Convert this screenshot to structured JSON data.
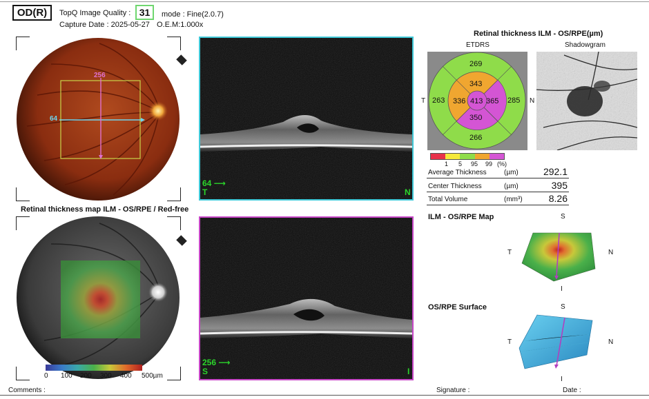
{
  "header": {
    "eye": "OD(R)",
    "quality_label": "TopQ Image Quality :",
    "quality_value": "31",
    "mode": "mode : Fine(2.0.7)",
    "capture_date": "Capture Date : 2025-05-27",
    "oem": "O.E.M:1.000x"
  },
  "fundus_top": {
    "scan_h_label": "64",
    "scan_v_label": "256"
  },
  "oct_top": {
    "scan_number": "64",
    "from_letter": "T",
    "to_letter": "N"
  },
  "oct_bottom": {
    "scan_number": "256",
    "from_letter": "S",
    "to_letter": "I"
  },
  "thickness_map": {
    "title": "Retinal thickness map ILM - OS/RPE / Red-free",
    "scale_ticks": [
      "0",
      "100",
      "200",
      "300",
      "400",
      "500µm"
    ]
  },
  "etdrs": {
    "section_title": "Retinal thickness ILM - OS/RPE(µm)",
    "etdrs_label": "ETDRS",
    "shadowgram_label": "Shadowgram",
    "side_left": "T",
    "side_right": "N",
    "center": "413",
    "inner": {
      "superior": "343",
      "temporal": "336",
      "nasal": "365",
      "inferior": "350"
    },
    "outer": {
      "superior": "269",
      "temporal": "263",
      "nasal": "285",
      "inferior": "266"
    },
    "legend_ticks": [
      "1",
      "5",
      "95",
      "99"
    ],
    "legend_unit": "(%)",
    "legend_colors": [
      "#e8324a",
      "#f5e93a",
      "#8fdc4a",
      "#f0a630",
      "#d455d4"
    ]
  },
  "measurements": [
    {
      "name": "Average Thickness",
      "unit": "(µm)",
      "value": "292.1"
    },
    {
      "name": "Center Thickness",
      "unit": "(µm)",
      "value": "395"
    },
    {
      "name": "Total Volume",
      "unit": "(mm³)",
      "value": "8.26"
    }
  ],
  "map3d": {
    "title": "ILM - OS/RPE Map",
    "top": "S",
    "left": "T",
    "right": "N",
    "bottom": "I"
  },
  "surface3d": {
    "title": "OS/RPE Surface",
    "top": "S",
    "left": "T",
    "right": "N",
    "bottom": "I"
  },
  "footer": {
    "comments": "Comments :",
    "signature": "Signature :",
    "date": "Date :"
  }
}
